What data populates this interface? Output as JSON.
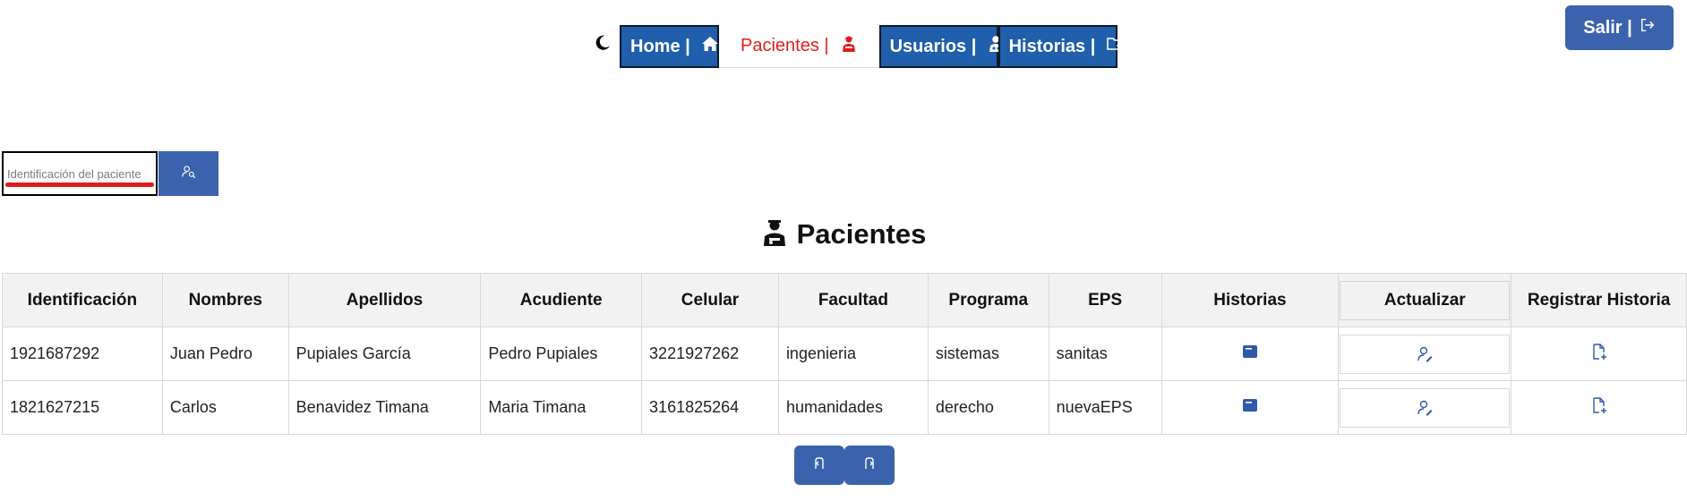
{
  "nav": {
    "theme_icon": "moon-icon",
    "items": [
      {
        "label": "Home |",
        "icon": "house-icon"
      },
      {
        "label": "Pacientes |",
        "icon": "patient-icon"
      },
      {
        "label": "Usuarios |",
        "icon": "doctor-icon"
      },
      {
        "label": "Historias |",
        "icon": "folder-icon"
      }
    ],
    "active": "Pacientes |"
  },
  "salir": {
    "label": "Salir |",
    "icon": "logout-icon"
  },
  "search": {
    "placeholder": "Identificación del paciente",
    "button_icon": "user-search-icon"
  },
  "page": {
    "title": "Pacientes",
    "title_icon": "patient-icon"
  },
  "table": {
    "headers": [
      "Identificación",
      "Nombres",
      "Apellidos",
      "Acudiente",
      "Celular",
      "Facultad",
      "Programa",
      "EPS",
      "Historias",
      "Actualizar",
      "Registrar Historia"
    ],
    "rows": [
      {
        "id": "1921687292",
        "nombres": "Juan Pedro",
        "apellidos": "Pupiales García",
        "acudiente": "Pedro Pupiales",
        "celular": "3221927262",
        "facultad": "ingenieria",
        "programa": "sistemas",
        "eps": "sanitas"
      },
      {
        "id": "1821627215",
        "nombres": "Carlos",
        "apellidos": "Benavidez Timana",
        "acudiente": "Maria Timana",
        "celular": "3161825264",
        "facultad": "humanidades",
        "programa": "derecho",
        "eps": "nuevaEPS"
      }
    ],
    "row_icons": {
      "historias": "book-icon",
      "actualizar": "user-edit-icon",
      "registrar": "file-add-icon"
    }
  },
  "pager": {
    "prev_icon": "previous-page-icon",
    "next_icon": "next-page-icon"
  },
  "colors": {
    "primary": "#1f5fac",
    "button": "#3b63ad",
    "active_text": "#e11d1d",
    "underline": "#e01b1b"
  }
}
